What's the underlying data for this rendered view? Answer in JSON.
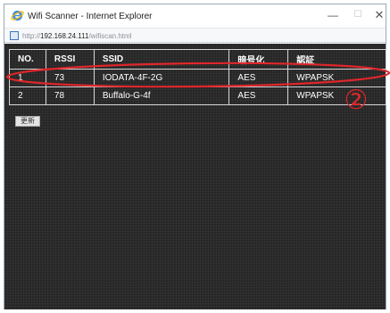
{
  "window": {
    "title": "Wifi Scanner - Internet Explorer",
    "minimize_glyph": "—",
    "maximize_glyph": "☐",
    "close_glyph": "✕"
  },
  "address": {
    "scheme": "http://",
    "host": "192.168.24.111",
    "path": "/wifiscan.html"
  },
  "table": {
    "headers": [
      "NO.",
      "RSSI",
      "SSID",
      "暗号化",
      "認証"
    ],
    "rows": [
      [
        "1",
        "73",
        "IODATA-4F-2G",
        "AES",
        "WPAPSK"
      ],
      [
        "2",
        "78",
        "Buffalo-G-4f",
        "AES",
        "WPAPSK"
      ]
    ]
  },
  "refresh_label": "更新",
  "annotation": {
    "marker": "②",
    "color": "#e0262a",
    "highlighted_row": 1
  },
  "colors": {
    "background": "#262626",
    "table_text": "#ffffff",
    "table_border": "#d6d6d6"
  },
  "icons": [
    "internet-explorer-icon",
    "page-icon"
  ]
}
